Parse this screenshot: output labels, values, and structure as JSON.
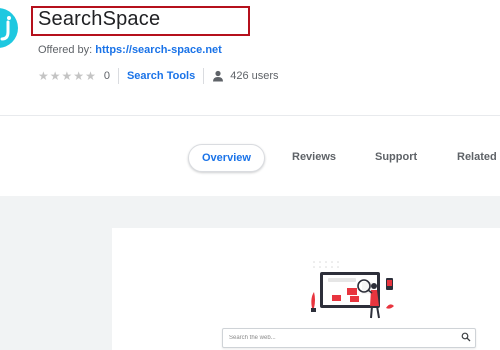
{
  "extension": {
    "name": "SearchSpace",
    "offered_by_label": "Offered by:",
    "offered_by_link": "https://search-space.net",
    "rating_count": "0",
    "category": "Search Tools",
    "users": "426 users",
    "stars_filled": 0,
    "stars_total": 5
  },
  "tabs": [
    {
      "label": "Overview",
      "active": true
    },
    {
      "label": "Reviews",
      "active": false
    },
    {
      "label": "Support",
      "active": false
    },
    {
      "label": "Related",
      "active": false
    }
  ],
  "preview": {
    "search_placeholder": "Search the web..."
  },
  "colors": {
    "accent": "#1a73e8",
    "logo": "#1ec8e0",
    "highlight_box": "#b5101c",
    "illustration_red": "#e8353f"
  }
}
